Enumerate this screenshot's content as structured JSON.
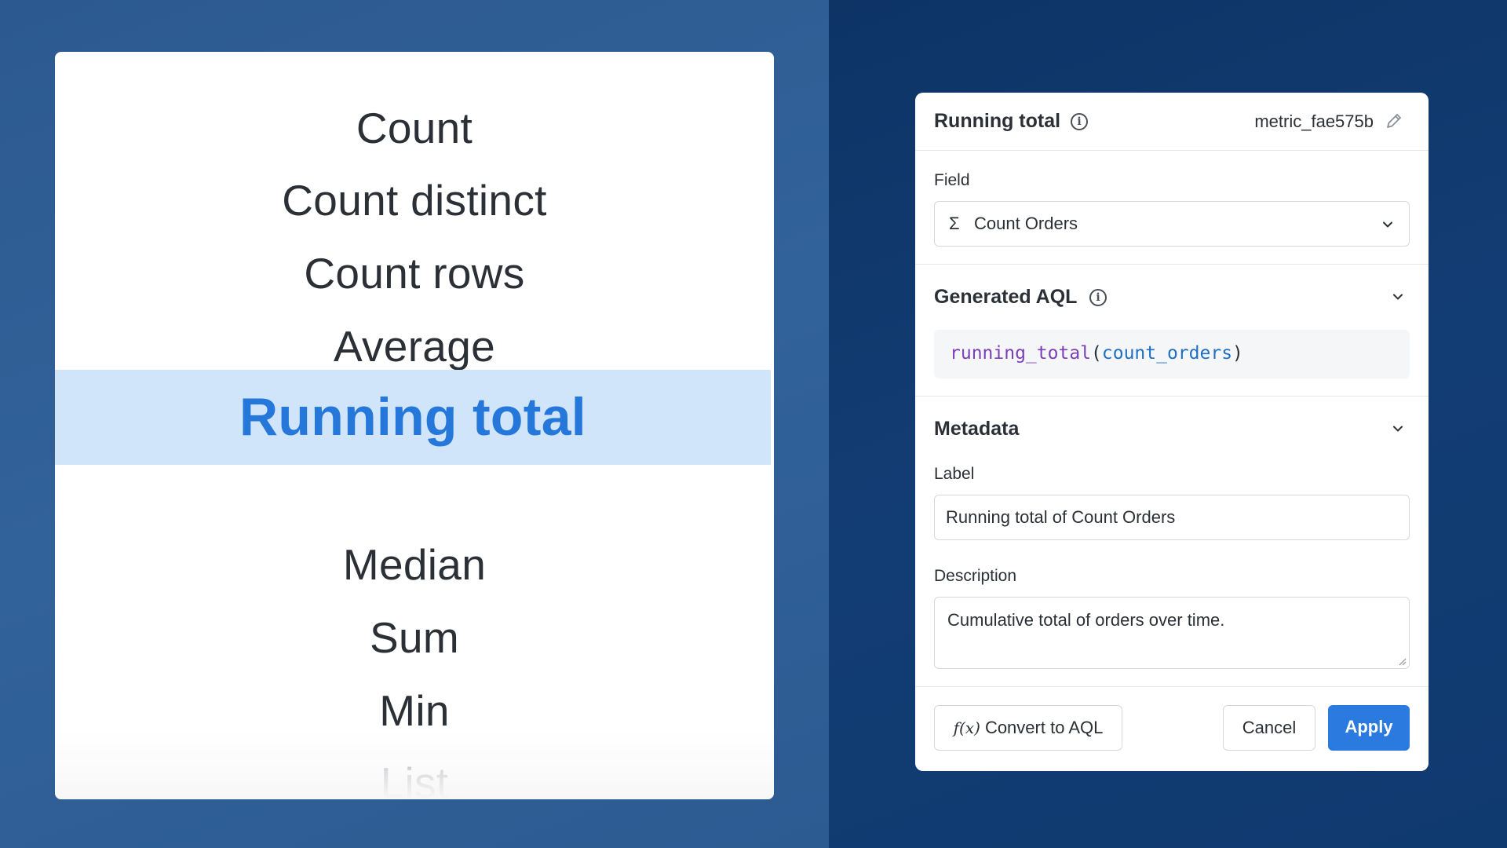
{
  "picker": {
    "items": [
      "Count",
      "Count distinct",
      "Count rows",
      "Average",
      "Running total",
      "Median",
      "Sum",
      "Min",
      "List"
    ],
    "selected": "Running total"
  },
  "editor": {
    "title": "Running total",
    "metric_id": "metric_fae575b",
    "field": {
      "label": "Field",
      "icon": "sigma-icon",
      "value": "Count Orders"
    },
    "generated_aql": {
      "title": "Generated AQL",
      "code_fn": "running_total",
      "code_open": "(",
      "code_arg": "count_orders",
      "code_close": ")"
    },
    "metadata": {
      "title": "Metadata",
      "label_caption": "Label",
      "label_value": "Running total of Count Orders",
      "description_caption": "Description",
      "description_value": "Cumulative total of orders over time."
    },
    "actions": {
      "convert": "Convert to AQL",
      "convert_icon": "f(x)",
      "cancel": "Cancel",
      "apply": "Apply"
    }
  },
  "colors": {
    "accent": "#2a7ae0",
    "selected_bg": "#d0e4fa",
    "selected_text": "#2577d9",
    "code_function": "#7b3fb8",
    "code_argument": "#1f6fc4"
  }
}
